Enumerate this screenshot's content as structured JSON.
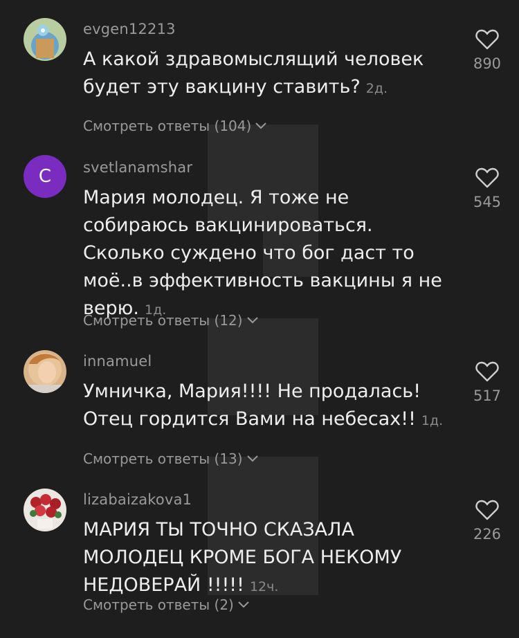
{
  "comments": [
    {
      "username": "evgen12213",
      "text": "А какой здравомыслящий человек будет эту вакцину ставить?",
      "time": "2д.",
      "replies": "Смотреть ответы (104)",
      "likes": "890",
      "avatar": {
        "type": "image",
        "bg": "#b8cda0"
      }
    },
    {
      "username": "svetlanamshar",
      "text": "Мария молодец. Я тоже не собираюсь вакцинироваться. Сколько суждено что бог даст то моё..в эффективность вакцины я не верю.",
      "time": "1д.",
      "replies": "Смотреть ответы (12)",
      "likes": "545",
      "avatar": {
        "type": "letter",
        "letter": "C",
        "bg": "#7a2bc0"
      }
    },
    {
      "username": "innamuel",
      "text": "Умничка, Мария!!!! Не продалась! Отец гордится Вами на небесах!!",
      "time": "1д.",
      "replies": "Смотреть ответы (13)",
      "likes": "517",
      "avatar": {
        "type": "image",
        "bg": "#c89a70"
      }
    },
    {
      "username": "lizabaizakova1",
      "text": "МАРИЯ ТЫ ТОЧНО СКАЗАЛА МОЛОДЕЦ КРОМЕ БОГА НЕКОМУ НЕДОВЕРАЙ !!!!!",
      "time": "12ч.",
      "replies": "Смотреть ответы (2)",
      "likes": "226",
      "avatar": {
        "type": "image",
        "bg": "#e8e0dc"
      }
    }
  ],
  "colors": {
    "background": "#1e1e1e",
    "text": "#eeeeee",
    "muted": "#9a9a9a"
  },
  "icons": {
    "like": "heart-outline-icon",
    "expand": "chevron-down-icon"
  }
}
